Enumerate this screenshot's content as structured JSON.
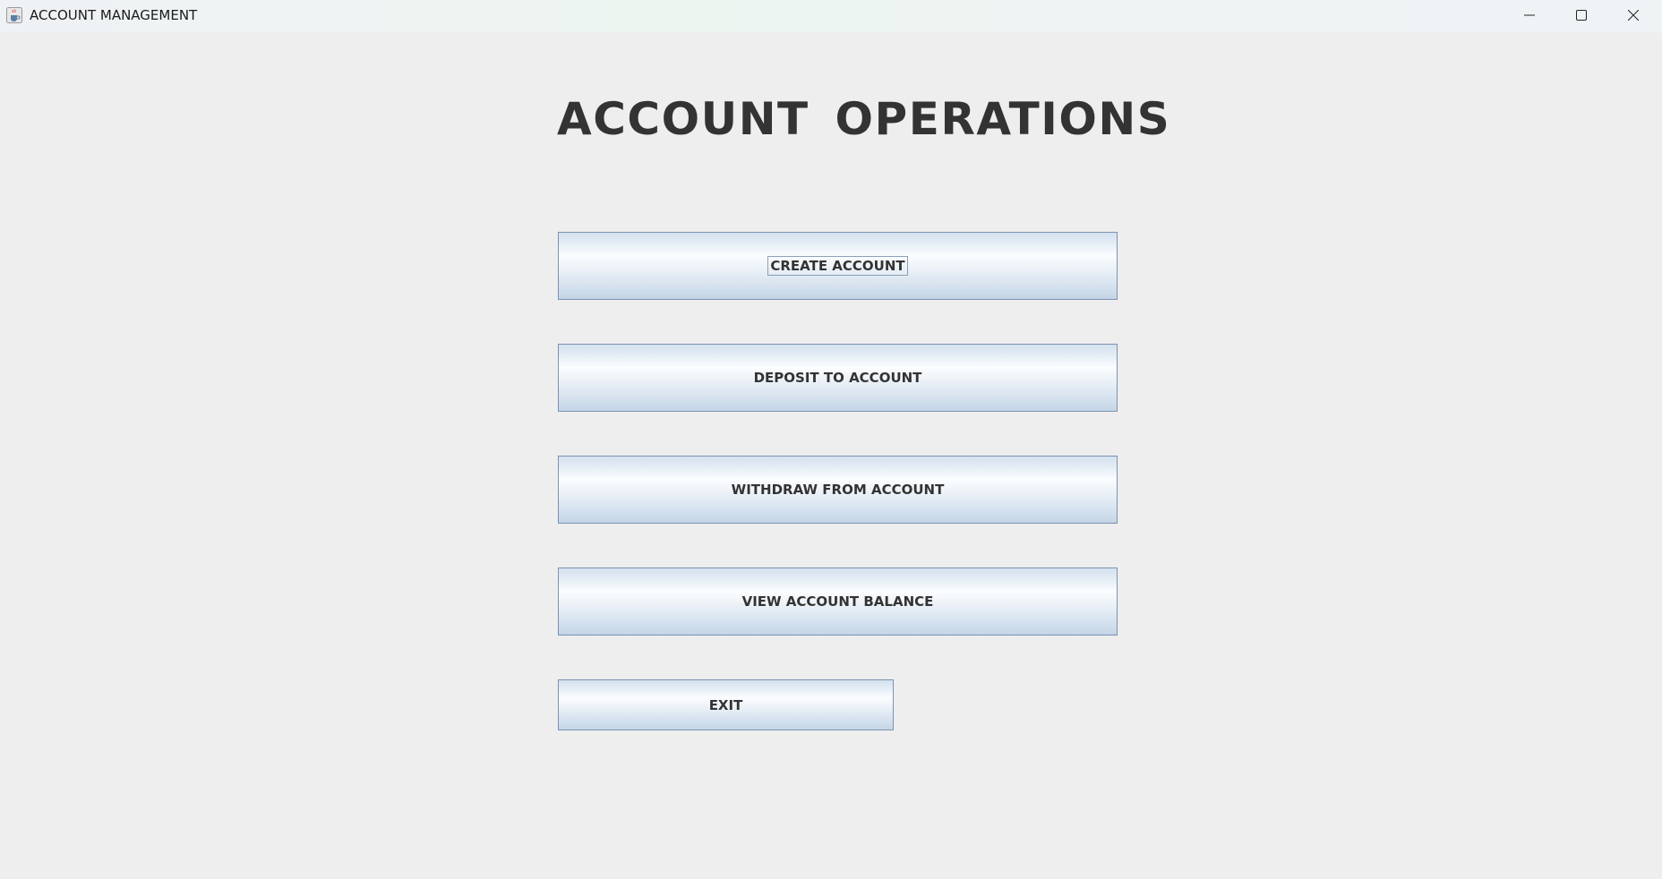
{
  "window": {
    "title": "ACCOUNT MANAGEMENT",
    "app_icon": "java-cup-icon",
    "controls": [
      "minimize-icon",
      "maximize-icon",
      "close-icon"
    ]
  },
  "main": {
    "heading": "ACCOUNT  OPERATIONS",
    "buttons": {
      "create": "CREATE ACCOUNT",
      "deposit": "DEPOSIT TO ACCOUNT",
      "withdraw": "WITHDRAW FROM ACCOUNT",
      "balance": "VIEW ACCOUNT BALANCE",
      "exit": "EXIT"
    },
    "focused_button": "create"
  },
  "colors": {
    "background": "#eeeeee",
    "heading_text": "#333333",
    "button_border": "#7a93b3",
    "button_gradient_light": "#fbfdff",
    "button_gradient_dark": "#c5d5e6"
  }
}
